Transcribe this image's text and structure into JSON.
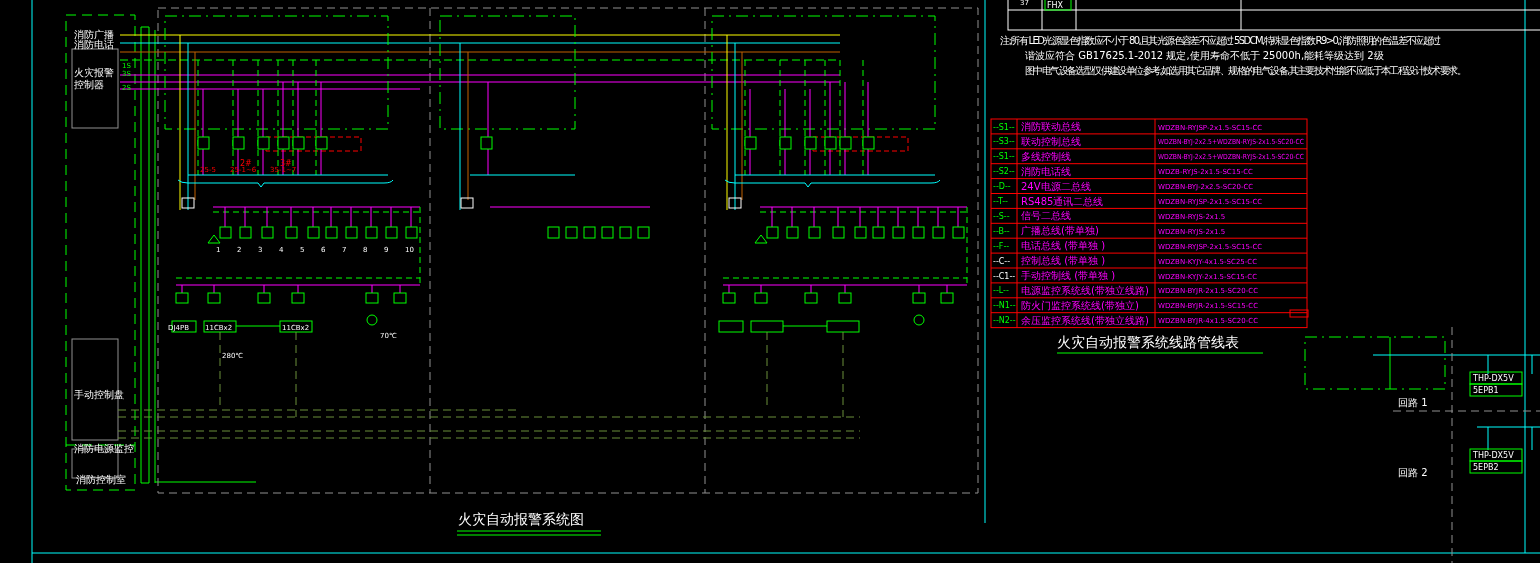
{
  "legend_table": {
    "row": {
      "number": "37",
      "code": "FHX"
    }
  },
  "notes": [
    "注:所有 LED光源显色指数应不小于 80,且其光源色容差不应超过 5SDCM,特殊显色指数 R9>0,消防照明的色温差不应超过",
    "谐波应符合 GB17625.1-2012 规定,使用寿命不低于 25000h,能耗等级达到 2级",
    "图中电气设备选型仅供建设单位参考,如选用其它品牌、规格的电气设备,其主要技术性能不应低于本工程设计技术要求。"
  ],
  "cable_table": {
    "title": "火灾自动报警系统线路管线表",
    "rows": [
      {
        "code": "--S1--",
        "description": "消防联动总线",
        "spec": "WDZBN-RYJSP-2x1.5-SC15-CC"
      },
      {
        "code": "--S3--",
        "description": "联动控制总线",
        "spec": "WDZBN-BYJ-2x2.5+WDZBN-RYJS-2x1.5-SC20-CC"
      },
      {
        "code": "--S1--",
        "description": "多线控制线",
        "spec": "WDZBN-BYJ-2x2.5+WDZBN-RYJS-2x1.5-SC20-CC"
      },
      {
        "code": "--S2--",
        "description": "消防电话线",
        "spec": "WDZB-RYJS-2x1.5-SC15-CC"
      },
      {
        "code": "--D--",
        "description": "24V电源二总线",
        "spec": "WDZBN-BYJ-2x2.5-SC20-CC"
      },
      {
        "code": "--T--",
        "description": "RS485通讯二总线",
        "spec": "WDZBN-RYJSP-2x1.5-SC15-CC"
      },
      {
        "code": "--S--",
        "description": "信号二总线",
        "spec": "WDZBN-RYJS-2x1.5"
      },
      {
        "code": "--B--",
        "description": "广播总线(带单独)",
        "spec": "WDZBN-RYJS-2x1.5"
      },
      {
        "code": "--F--",
        "description": "电话总线 (带单独 )",
        "spec": "WDZBN-RYJSP-2x1.5-SC15-CC"
      },
      {
        "code": "--C--",
        "description": "控制总线 (带单独 )",
        "spec": "WDZBN-KYJY-4x1.5-SC25-CC"
      },
      {
        "code": "--C1--",
        "description": "手动控制线 (带单独 )",
        "spec": "WDZBN-KYJY-2x1.5-SC15-CC"
      },
      {
        "code": "--L--",
        "description": "电源监控系统线(带独立线路)",
        "spec": "WDZBN-BYJR-2x1.5-SC20-CC"
      },
      {
        "code": "--N1--",
        "description": "防火门监控系统线(带独立)",
        "spec": "WDZBN-BYJR-2x1.5-SC15-CC"
      },
      {
        "code": "--N2--",
        "description": "余压监控系统线(带独立线路)",
        "spec": "WDZBN-BYJR-4x1.5-SC20-CC"
      }
    ]
  },
  "system_diagram": {
    "title": "火灾自动报警系统图",
    "left_labels": [
      "消防广播",
      "消防电话",
      "火灾报警",
      "控制器",
      "手动控制盘",
      "消防电源监控",
      "消防控制室"
    ],
    "bus_labels": [
      "1S",
      "3S",
      "2S"
    ],
    "floor_labels": [
      {
        "text": "2#"
      },
      {
        "text": "3#"
      }
    ],
    "loop_labels": [
      "25-5",
      "25-1~6",
      "35-1~7"
    ],
    "device_labels": [
      "1",
      "2",
      "3",
      "4",
      "5",
      "6",
      "7",
      "8",
      "9",
      "10"
    ],
    "module_labels": [
      "DJ4PB",
      "11CBx2",
      "280℃",
      "11CBx2",
      "70℃"
    ]
  },
  "linkage_diagram": {
    "group_labels": [
      "回路 1",
      "回路 2"
    ],
    "boxes": [
      "THP-DX5V",
      "5EPB1",
      "THP-DX5V",
      "5EPB2"
    ]
  }
}
